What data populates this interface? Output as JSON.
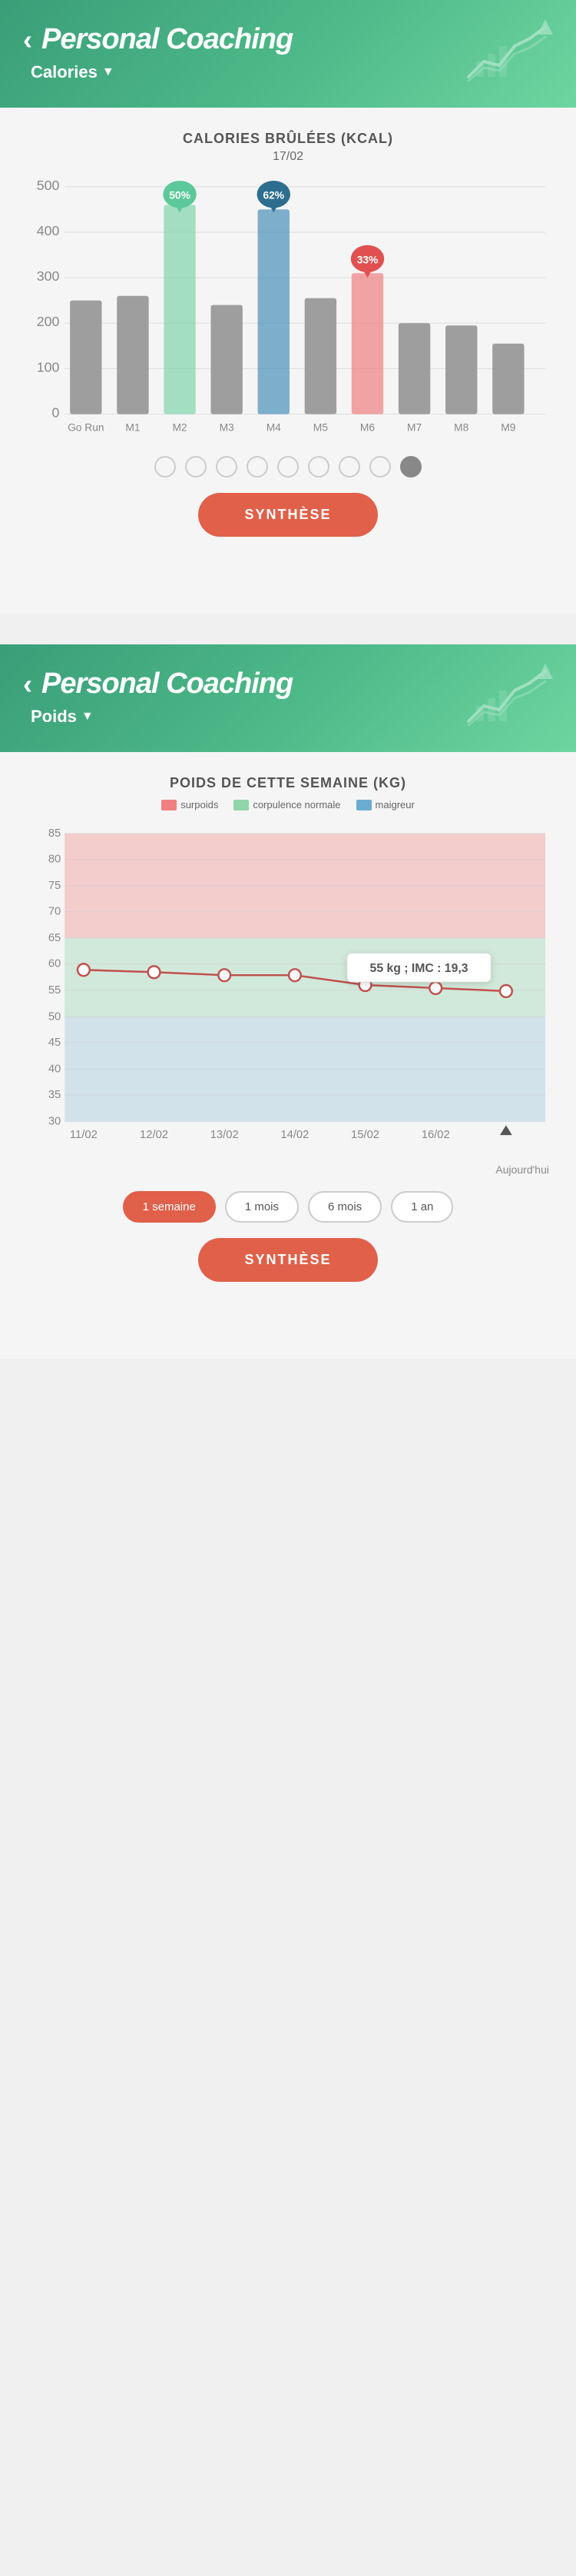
{
  "section1": {
    "header": {
      "back_label": "‹",
      "title": "Personal Coaching",
      "subtitle": "Calories",
      "subtitle_chevron": "▼"
    },
    "chart": {
      "title": "CALORIES BRÛLÉES (kcal)",
      "date": "17/02",
      "bars": [
        {
          "label": "Go Run",
          "value": 250,
          "color": "#888888",
          "highlight": false
        },
        {
          "label": "M1",
          "value": 260,
          "color": "#888888",
          "highlight": false
        },
        {
          "label": "M2",
          "value": 460,
          "color": "#5cc99a",
          "highlight": true,
          "pct": "50%",
          "pin_color": "#5cc99a"
        },
        {
          "label": "M3",
          "value": 240,
          "color": "#888888",
          "highlight": false
        },
        {
          "label": "M4",
          "value": 450,
          "color": "#2d7fa0",
          "highlight": true,
          "pct": "62%",
          "pin_color": "#2d7fa0"
        },
        {
          "label": "M5",
          "value": 255,
          "color": "#888888",
          "highlight": false
        },
        {
          "label": "M6",
          "value": 310,
          "color": "#e87070",
          "highlight": true,
          "pct": "33%",
          "pin_color": "#e87070"
        },
        {
          "label": "M7",
          "value": 200,
          "color": "#888888",
          "highlight": false
        },
        {
          "label": "M8",
          "value": 195,
          "color": "#888888",
          "highlight": false
        },
        {
          "label": "M9",
          "value": 155,
          "color": "#888888",
          "highlight": false
        }
      ],
      "y_labels": [
        "0",
        "100",
        "200",
        "300",
        "400",
        "500"
      ],
      "y_max": 500
    },
    "dots": {
      "total": 9,
      "active_index": 8
    },
    "synthese_btn": "SYNTHÈSE"
  },
  "section2": {
    "header": {
      "back_label": "‹",
      "title": "Personal Coaching",
      "subtitle": "Poids",
      "subtitle_chevron": "▼"
    },
    "chart": {
      "title": "POIDS DE CETTE SEMAINE (kg)",
      "legend": [
        {
          "label": "surpoids",
          "color": "#f08080"
        },
        {
          "label": "corpulence normale",
          "color": "#90d4a8"
        },
        {
          "label": "maigreur",
          "color": "#6aaccf"
        }
      ],
      "x_labels": [
        "11/02",
        "12/02",
        "13/02",
        "14/02",
        "15/02",
        "16/02"
      ],
      "y_labels": [
        "30",
        "35",
        "40",
        "45",
        "50",
        "55",
        "60",
        "65",
        "70",
        "75",
        "80",
        "85"
      ],
      "data_points": [
        59,
        58.5,
        58,
        58,
        56,
        55.5,
        55
      ],
      "tooltip": "55 kg ; IMC : 19,3",
      "today_label": "Aujourd'hui",
      "triangle_label": "▲"
    },
    "time_buttons": [
      "1 semaine",
      "1 mois",
      "6 mois",
      "1 an"
    ],
    "active_time_btn": 0,
    "synthese_btn": "SYNTHÈSE"
  },
  "icons": {
    "chart_icon": "📈"
  }
}
